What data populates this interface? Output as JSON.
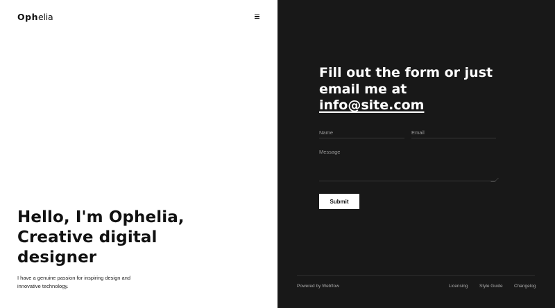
{
  "header": {
    "logo_bold": "Oph",
    "logo_light": "elia",
    "menu_icon": "hamburger-menu-icon"
  },
  "hero": {
    "title_line1": "Hello, I'm Ophelia,",
    "title_line2": "Creative digital",
    "title_line3": "designer",
    "text_line1": "I have a genuine passion for inspiring design and",
    "text_line2": "innovative technology."
  },
  "contact": {
    "heading_line1": "Fill out the form or just",
    "heading_line2": "email me at",
    "email": "info@site.com",
    "name_placeholder": "Name",
    "email_placeholder": "Email",
    "message_placeholder": "Message",
    "submit_label": "Submit"
  },
  "footer": {
    "powered_by": "Powered by Webflow",
    "links": [
      "Licensing",
      "Style Guide",
      "Changelog"
    ]
  },
  "colors": {
    "dark_panel": "#181818",
    "light_panel": "#ffffff",
    "accent": "#ffffff"
  }
}
